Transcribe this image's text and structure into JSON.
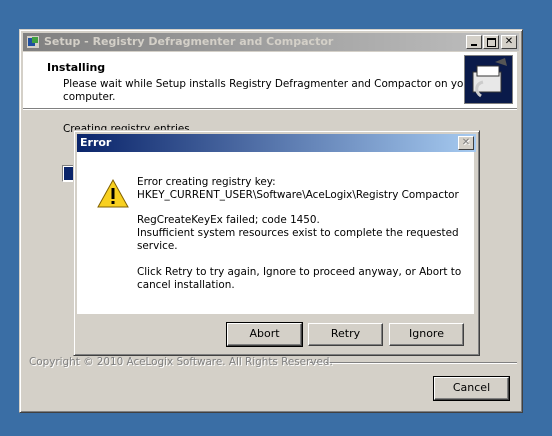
{
  "setup_window": {
    "title": "Setup - Registry Defragmenter and Compactor",
    "header_title": "Installing",
    "header_desc_line1": "Please wait while Setup installs Registry Defragmenter and Compactor on your",
    "header_desc_line2": "computer.",
    "status_text": "Creating registry entries...",
    "progress": 0.06,
    "copyright": "Copyright © 2010 AceLogix Software. All Rights Reserved.",
    "cancel_label": "Cancel"
  },
  "error_dialog": {
    "title": "Error",
    "line1": "Error creating registry key:",
    "line2": "HKEY_CURRENT_USER\\Software\\AceLogix\\Registry Compactor",
    "line3": "RegCreateKeyEx failed; code 1450.",
    "line4": "Insufficient system resources exist to complete the requested",
    "line5": "service.",
    "line6": "Click Retry to try again, Ignore to proceed anyway, or Abort to",
    "line7": "cancel installation.",
    "abort_label": "Abort",
    "retry_label": "Retry",
    "ignore_label": "Ignore",
    "close_glyph": "✕"
  },
  "colors": {
    "desktop": "#3a6ea5",
    "title_active": "#0a246a",
    "title_inactive": "#808080",
    "progress_fill": "#0a246a"
  }
}
